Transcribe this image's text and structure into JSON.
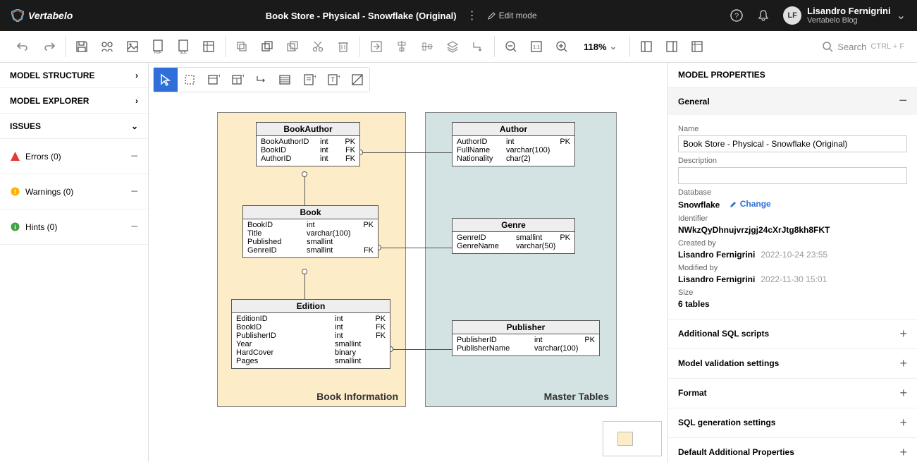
{
  "topbar": {
    "logo_text": "Vertabelo",
    "doc_title": "Book Store - Physical - Snowflake (Original)",
    "edit_mode_label": "Edit mode",
    "user": {
      "initials": "LF",
      "name": "Lisandro Fernigrini",
      "sub": "Vertabelo Blog"
    }
  },
  "toolbar": {
    "zoom": "118%",
    "search_placeholder": "Search",
    "search_hint": "CTRL + F"
  },
  "left_sidebar": {
    "sections": [
      {
        "label": "MODEL STRUCTURE",
        "arrow": "›"
      },
      {
        "label": "MODEL EXPLORER",
        "arrow": "›"
      },
      {
        "label": "ISSUES",
        "arrow": "⌄"
      }
    ],
    "issues": [
      {
        "icon": "error",
        "label": "Errors (0)"
      },
      {
        "icon": "warning",
        "label": "Warnings (0)"
      },
      {
        "icon": "hint",
        "label": "Hints (0)"
      }
    ]
  },
  "canvas": {
    "subject_areas": [
      {
        "label": "Book Information"
      },
      {
        "label": "Master Tables"
      }
    ],
    "tables": {
      "book_author": {
        "title": "BookAuthor",
        "rows": [
          {
            "name": "BookAuthorID",
            "type": "int",
            "key": "PK"
          },
          {
            "name": "BookID",
            "type": "int",
            "key": "FK"
          },
          {
            "name": "AuthorID",
            "type": "int",
            "key": "FK"
          }
        ]
      },
      "book": {
        "title": "Book",
        "rows": [
          {
            "name": "BookID",
            "type": "int",
            "key": "PK"
          },
          {
            "name": "Title",
            "type": "varchar(100)",
            "key": ""
          },
          {
            "name": "Published",
            "type": "smallint",
            "key": ""
          },
          {
            "name": "GenreID",
            "type": "smallint",
            "key": "FK"
          }
        ]
      },
      "edition": {
        "title": "Edition",
        "rows": [
          {
            "name": "EditionID",
            "type": "int",
            "key": "PK"
          },
          {
            "name": "BookID",
            "type": "int",
            "key": "FK"
          },
          {
            "name": "PublisherID",
            "type": "int",
            "key": "FK"
          },
          {
            "name": "Year",
            "type": "smallint",
            "key": ""
          },
          {
            "name": "HardCover",
            "type": "binary",
            "key": ""
          },
          {
            "name": "Pages",
            "type": "smallint",
            "key": ""
          }
        ]
      },
      "author": {
        "title": "Author",
        "rows": [
          {
            "name": "AuthorID",
            "type": "int",
            "key": "PK"
          },
          {
            "name": "FullName",
            "type": "varchar(100)",
            "key": ""
          },
          {
            "name": "Nationality",
            "type": "char(2)",
            "key": ""
          }
        ]
      },
      "genre": {
        "title": "Genre",
        "rows": [
          {
            "name": "GenreID",
            "type": "smallint",
            "key": "PK"
          },
          {
            "name": "GenreName",
            "type": "varchar(50)",
            "key": ""
          }
        ]
      },
      "publisher": {
        "title": "Publisher",
        "rows": [
          {
            "name": "PublisherID",
            "type": "int",
            "key": "PK"
          },
          {
            "name": "PublisherName",
            "type": "varchar(100)",
            "key": ""
          }
        ]
      }
    }
  },
  "right_panel": {
    "title": "MODEL PROPERTIES",
    "general_label": "General",
    "name_label": "Name",
    "name_value": "Book Store - Physical - Snowflake (Original)",
    "description_label": "Description",
    "description_value": "",
    "database_label": "Database",
    "database_value": "Snowflake",
    "change_label": "Change",
    "identifier_label": "Identifier",
    "identifier_value": "NWkzQyDhnujvrzjgj24cXrJtg8kh8FKT",
    "created_by_label": "Created by",
    "created_by_name": "Lisandro Fernigrini",
    "created_by_date": "2022-10-24 23:55",
    "modified_by_label": "Modified by",
    "modified_by_name": "Lisandro Fernigrini",
    "modified_by_date": "2022-11-30 15:01",
    "size_label": "Size",
    "size_value": "6 tables",
    "collapsed_sections": [
      "Additional SQL scripts",
      "Model validation settings",
      "Format",
      "SQL generation settings",
      "Default Additional Properties"
    ]
  }
}
